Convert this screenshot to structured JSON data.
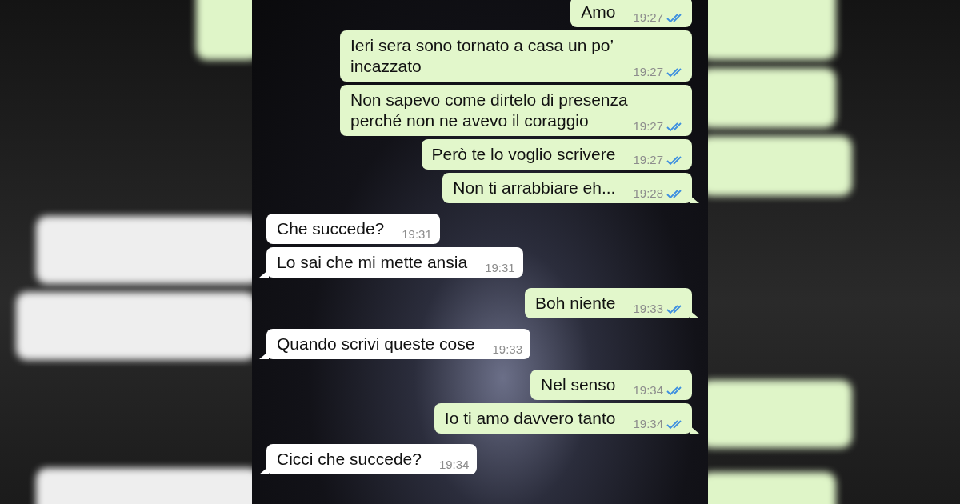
{
  "messages": [
    {
      "kind": "sent",
      "text": "Amo",
      "time": "19:27",
      "read": true,
      "tail": false
    },
    {
      "kind": "sent",
      "text": "Ieri sera sono tornato a casa un po’ incazzato",
      "time": "19:27",
      "read": true,
      "tail": false
    },
    {
      "kind": "sent",
      "text": "Non sapevo come dirtelo di presenza perché non ne avevo il coraggio",
      "time": "19:27",
      "read": true,
      "tail": false
    },
    {
      "kind": "sent",
      "text": "Però te lo voglio scrivere",
      "time": "19:27",
      "read": true,
      "tail": false
    },
    {
      "kind": "sent",
      "text": "Non ti arrabbiare eh...",
      "time": "19:28",
      "read": true,
      "tail": true
    },
    {
      "kind": "received",
      "text": "Che succede?",
      "time": "19:31",
      "tail": false
    },
    {
      "kind": "received",
      "text": "Lo sai che mi mette ansia",
      "time": "19:31",
      "tail": true
    },
    {
      "kind": "sent",
      "text": "Boh niente",
      "time": "19:33",
      "read": true,
      "tail": true
    },
    {
      "kind": "received",
      "text": "Quando scrivi queste cose",
      "time": "19:33",
      "tail": true
    },
    {
      "kind": "sent",
      "text": "Nel senso",
      "time": "19:34",
      "read": true,
      "tail": false
    },
    {
      "kind": "sent",
      "text": "Io ti amo davvero tanto",
      "time": "19:34",
      "read": true,
      "tail": true
    },
    {
      "kind": "received",
      "text": "Cicci che succede?",
      "time": "19:34",
      "tail": true
    }
  ]
}
